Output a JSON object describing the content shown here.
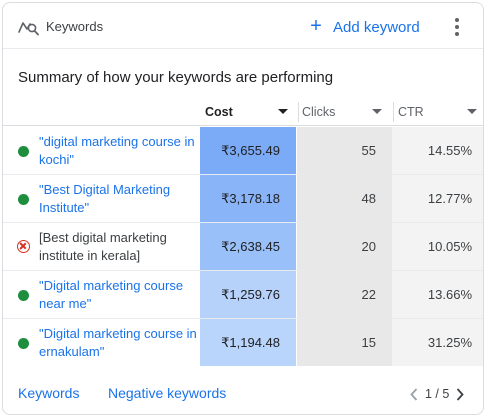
{
  "header": {
    "title": "Keywords",
    "icon": "keyword-search-icon",
    "add_label": "Add keyword",
    "more_icon": "more-vert-icon"
  },
  "summary": "Summary of how your keywords are performing",
  "columns": {
    "cost": "Cost",
    "clicks": "Clicks",
    "ctr": "CTR",
    "sorted_by": "Cost"
  },
  "rows": [
    {
      "keyword": "\"digital marketing course in kochi\"",
      "status": "enabled",
      "cost": "₹3,655.49",
      "cost_color": "#7baaf7",
      "clicks": "55",
      "ctr": "14.55%"
    },
    {
      "keyword": "\"Best Digital Marketing Institute\"",
      "status": "enabled",
      "cost": "₹3,178.18",
      "cost_color": "#8ab4f8",
      "clicks": "48",
      "ctr": "12.77%"
    },
    {
      "keyword": "[Best digital marketing institute in kerala]",
      "status": "removed",
      "cost": "₹2,638.45",
      "cost_color": "#99c0f9",
      "clicks": "20",
      "ctr": "10.05%"
    },
    {
      "keyword": "\"Digital marketing course near me\"",
      "status": "enabled",
      "cost": "₹1,259.76",
      "cost_color": "#b6d2fb",
      "clicks": "22",
      "ctr": "13.66%"
    },
    {
      "keyword": "\"Digital marketing course in ernakulam\"",
      "status": "enabled",
      "cost": "₹1,194.48",
      "cost_color": "#bad5fb",
      "clicks": "15",
      "ctr": "31.25%"
    }
  ],
  "footer": {
    "keywords_link": "Keywords",
    "negative_link": "Negative keywords",
    "page_info": "1 / 5"
  },
  "colors": {
    "accent": "#1a73e8",
    "enabled": "#1e8e3e",
    "removed": "#d93025"
  }
}
